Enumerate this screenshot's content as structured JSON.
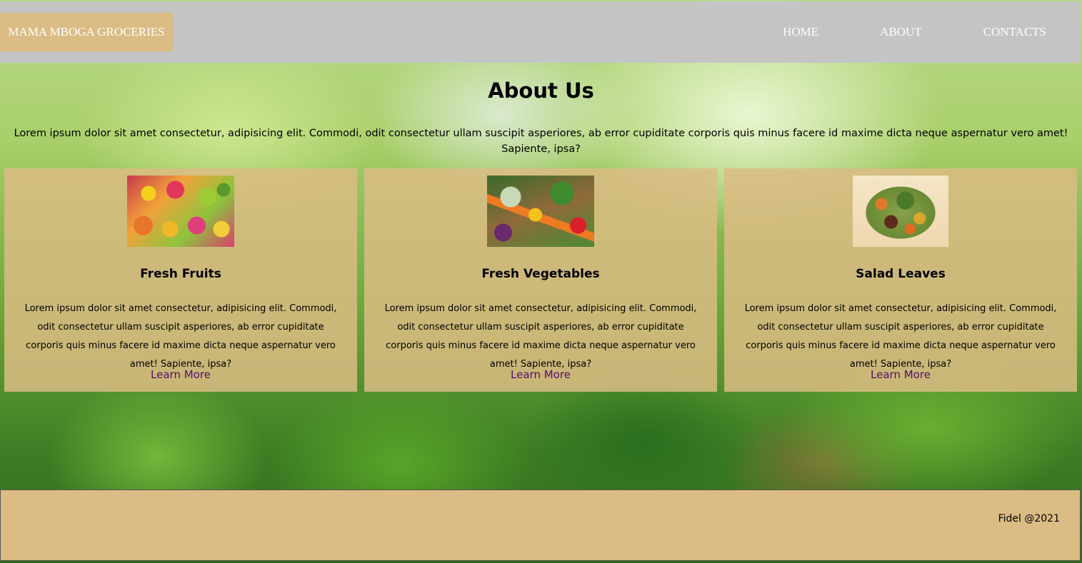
{
  "header": {
    "brand": "MAMA MBOGA GROCERIES",
    "nav": [
      "HOME",
      "ABOUT",
      "CONTACTS"
    ]
  },
  "about": {
    "title": "About Us",
    "text": "Lorem ipsum dolor sit amet consectetur, adipisicing elit. Commodi, odit consectetur ullam suscipit asperiores, ab error cupiditate corporis quis minus facere id maxime dicta neque aspernatur vero amet! Sapiente, ipsa?"
  },
  "cards": [
    {
      "title": "Fresh Fruits",
      "text": "Lorem ipsum dolor sit amet consectetur, adipisicing elit. Commodi, odit consectetur ullam suscipit asperiores, ab error cupiditate corporis quis minus facere id maxime dicta neque aspernatur vero amet! Sapiente, ipsa?",
      "link": "Learn More"
    },
    {
      "title": "Fresh Vegetables",
      "text": "Lorem ipsum dolor sit amet consectetur, adipisicing elit. Commodi, odit consectetur ullam suscipit asperiores, ab error cupiditate corporis quis minus facere id maxime dicta neque aspernatur vero amet! Sapiente, ipsa?",
      "link": "Learn More"
    },
    {
      "title": "Salad Leaves",
      "text": "Lorem ipsum dolor sit amet consectetur, adipisicing elit. Commodi, odit consectetur ullam suscipit asperiores, ab error cupiditate corporis quis minus facere id maxime dicta neque aspernatur vero amet! Sapiente, ipsa?",
      "link": "Learn More"
    }
  ],
  "footer": {
    "credit": "Fidel @2021"
  },
  "colors": {
    "header_bg": "#c4c4c4",
    "accent_tan": "#dbbc84",
    "link_purple": "#5b0a6a",
    "background": "broccoli-photo"
  }
}
